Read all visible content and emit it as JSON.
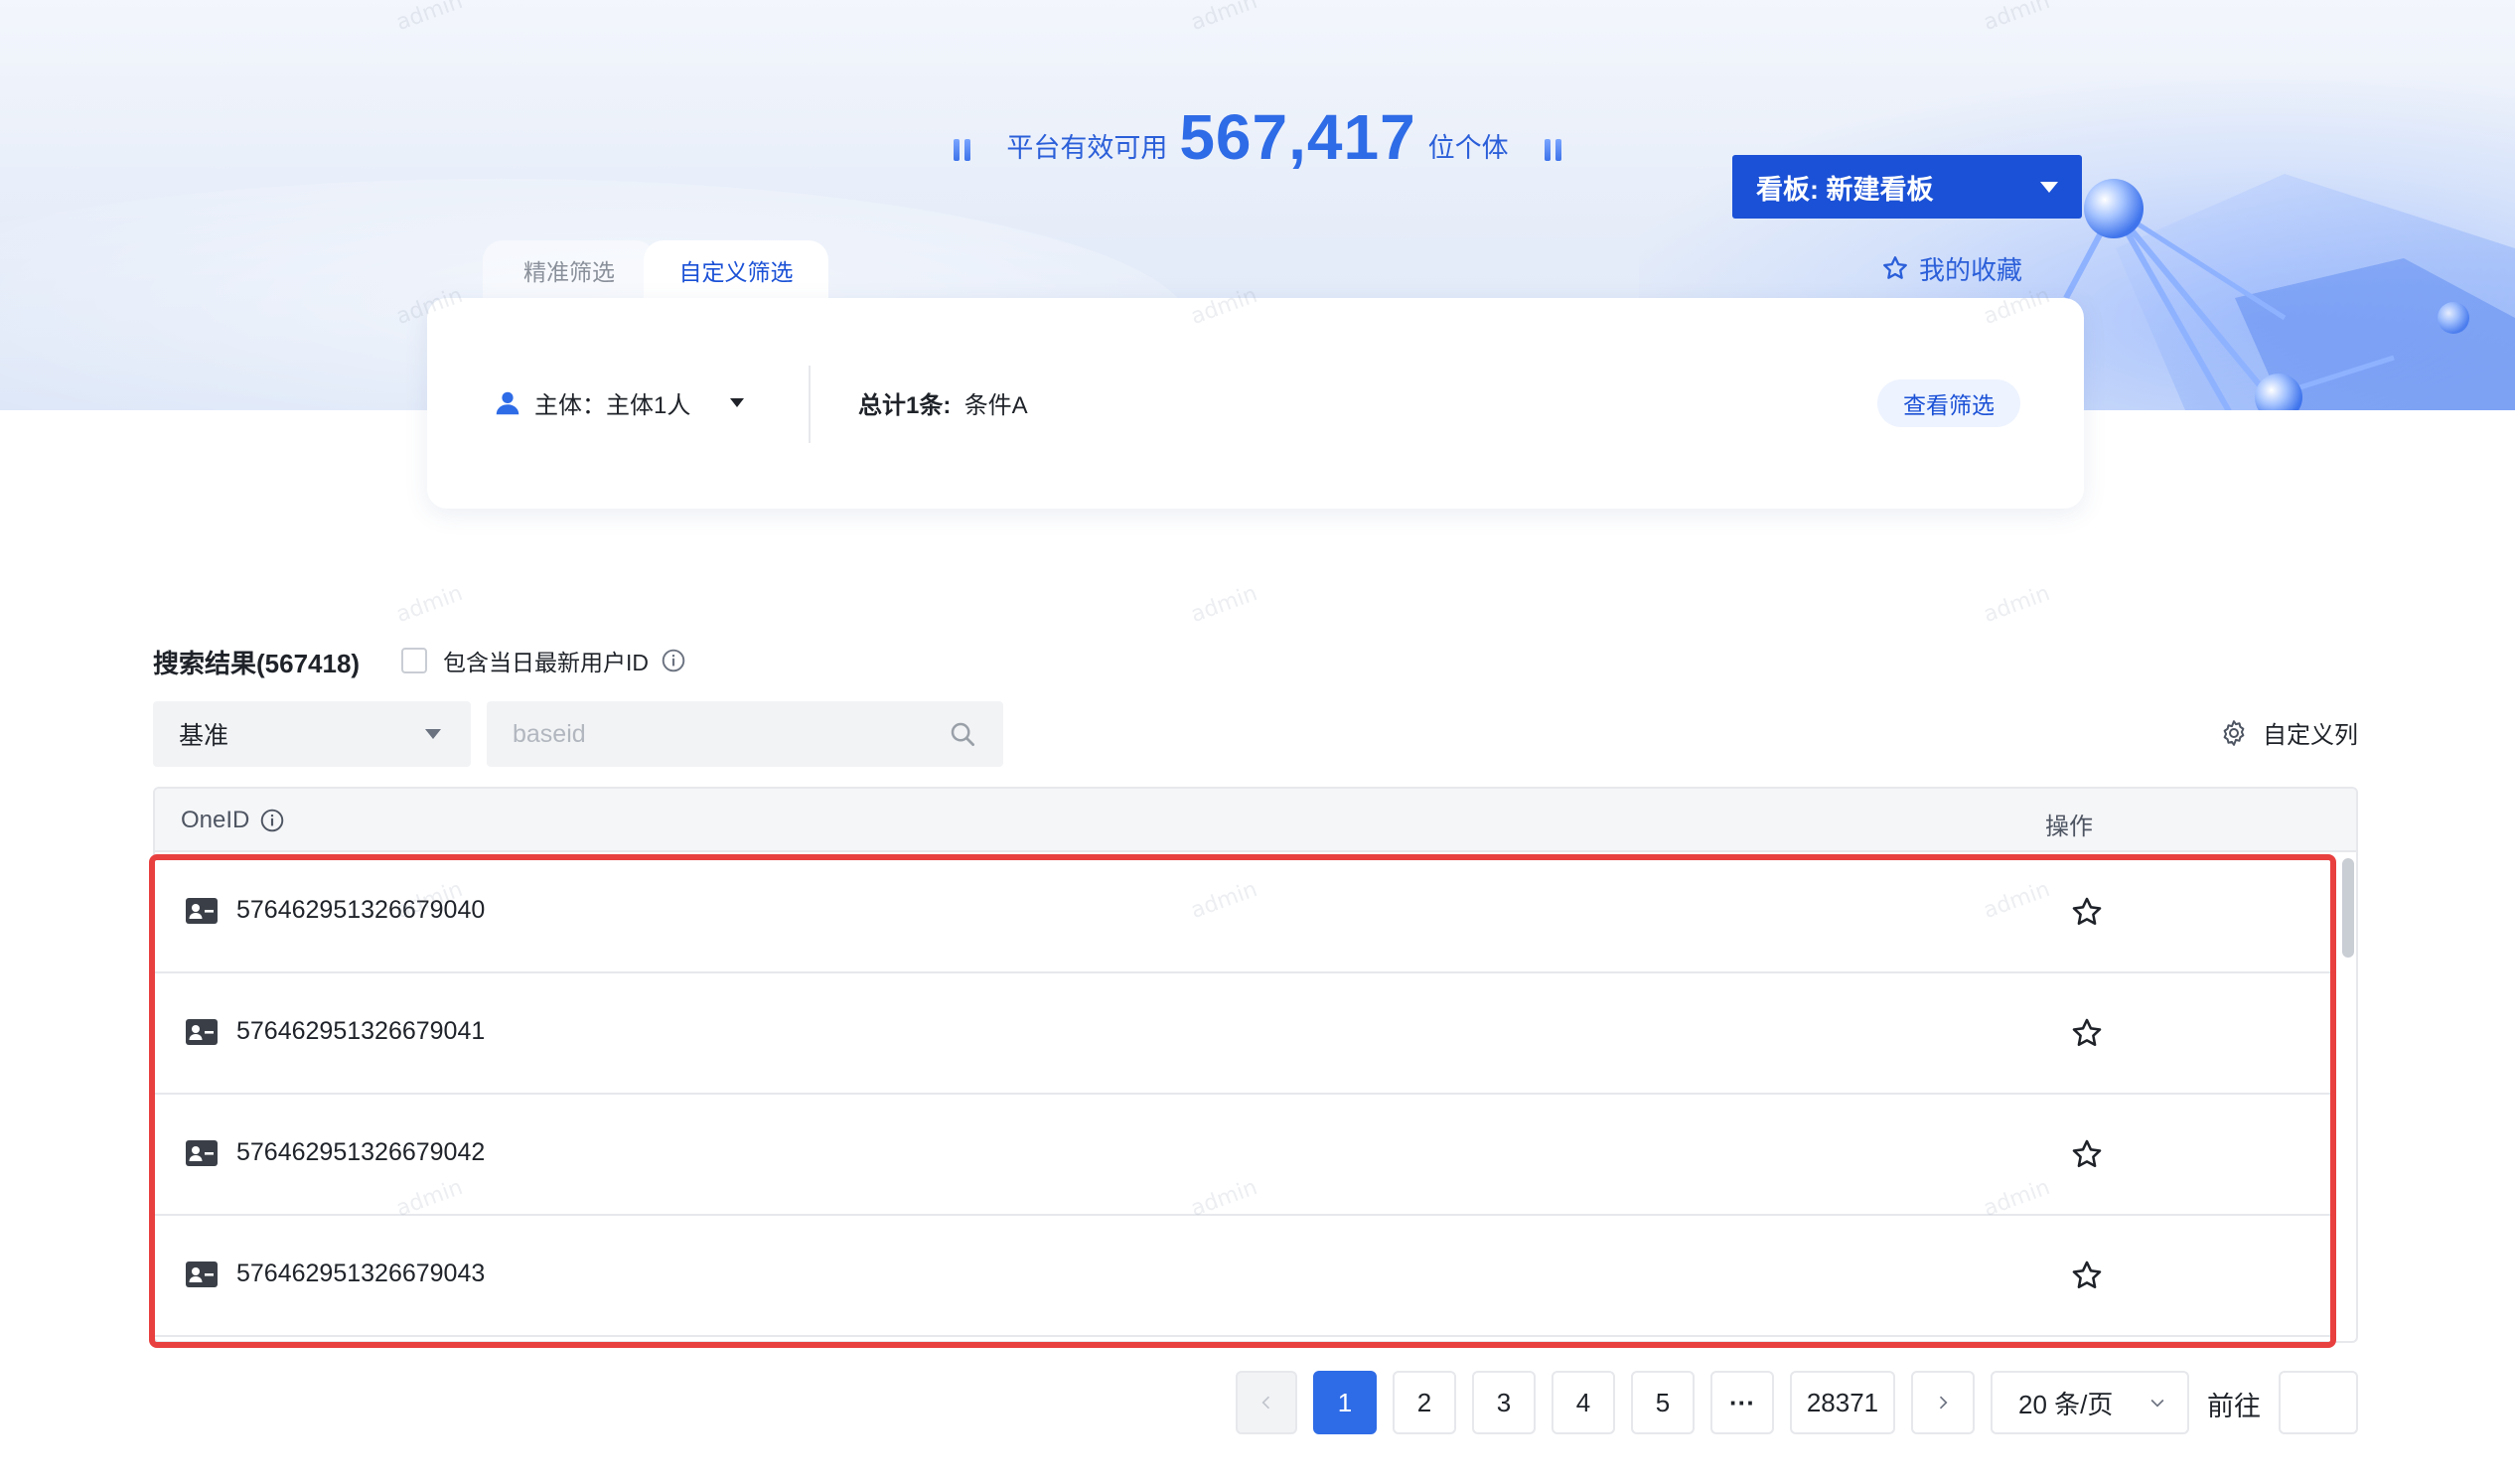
{
  "header": {
    "prefix": "平台有效可用",
    "count": "567,417",
    "suffix": "位个体",
    "board_select": "看板: 新建看板",
    "favorites": "我的收藏"
  },
  "tabs": [
    {
      "label": "精准筛选",
      "active": false
    },
    {
      "label": "自定义筛选",
      "active": true
    }
  ],
  "filter": {
    "subject_label": "主体：主体1人",
    "total_label": "总计1条:",
    "condition": "条件A",
    "view_button": "查看筛选"
  },
  "results": {
    "title": "搜索结果(567418)",
    "include_latest_label": "包含当日最新用户ID",
    "base_select_value": "基准",
    "search_placeholder": "baseid",
    "custom_columns": "自定义列"
  },
  "table": {
    "columns": [
      "OneID",
      "操作"
    ],
    "rows": [
      {
        "oneid": "576462951326679040"
      },
      {
        "oneid": "576462951326679041"
      },
      {
        "oneid": "576462951326679042"
      },
      {
        "oneid": "576462951326679043"
      }
    ]
  },
  "pagination": {
    "pages": [
      "1",
      "2",
      "3",
      "4",
      "5"
    ],
    "ellipsis": "···",
    "last_page": "28371",
    "page_size": "20 条/页",
    "goto_label": "前往",
    "current": "1"
  },
  "watermark": "admin",
  "colors": {
    "primary": "#2e6be6",
    "board": "#1b51d6",
    "highlight": "#e8403f"
  }
}
